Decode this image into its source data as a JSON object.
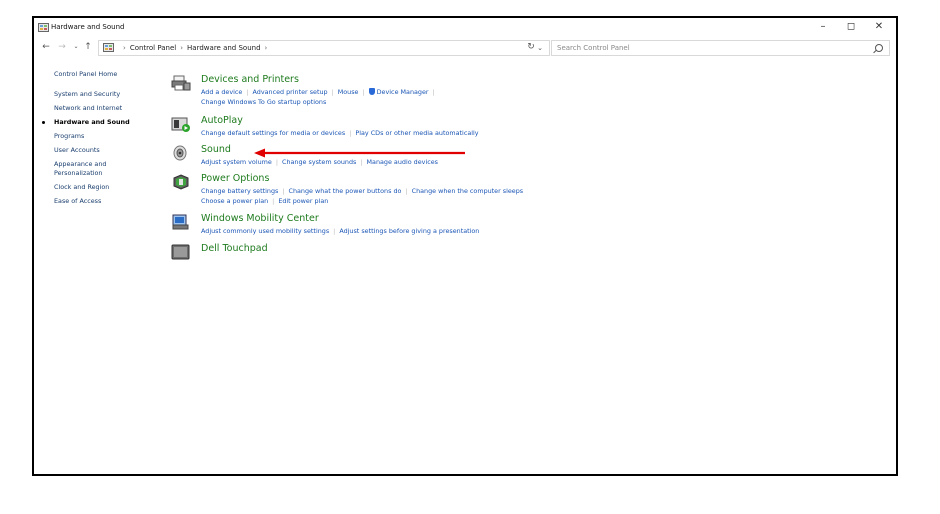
{
  "window": {
    "title": "Hardware and Sound",
    "controls": {
      "minimize": "–",
      "restore": "◻",
      "close": "✕"
    }
  },
  "nav": {
    "back_icon": "arrow-left-icon",
    "forward_icon": "arrow-right-icon",
    "recent_icon": "chevron-down-icon",
    "up_icon": "arrow-up-icon",
    "breadcrumbs": [
      "Control Panel",
      "Hardware and Sound"
    ],
    "search_placeholder": "Search Control Panel"
  },
  "sidebar": {
    "items": [
      {
        "label": "Control Panel Home"
      },
      {
        "label": "System and Security"
      },
      {
        "label": "Network and Internet"
      },
      {
        "label": "Hardware and Sound",
        "current": true
      },
      {
        "label": "Programs"
      },
      {
        "label": "User Accounts"
      },
      {
        "label": "Appearance and"
      },
      {
        "label": "Personalization"
      },
      {
        "label": "Clock and Region"
      },
      {
        "label": "Ease of Access"
      }
    ]
  },
  "categories": [
    {
      "title": "Devices and Printers",
      "icon": "printer-icon",
      "links_line1": [
        "Add a device",
        "Advanced printer setup",
        "Mouse",
        "Device Manager"
      ],
      "links_line2": [
        "Change Windows To Go startup options"
      ]
    },
    {
      "title": "AutoPlay",
      "icon": "autoplay-icon",
      "links_line1": [
        "Change default settings for media or devices",
        "Play CDs or other media automatically"
      ]
    },
    {
      "title": "Sound",
      "icon": "speaker-icon",
      "links_line1": [
        "Adjust system volume",
        "Change system sounds",
        "Manage audio devices"
      ]
    },
    {
      "title": "Power Options",
      "icon": "battery-icon",
      "links_line1": [
        "Change battery settings",
        "Change what the power buttons do",
        "Change when the computer sleeps"
      ],
      "links_line2": [
        "Choose a power plan",
        "Edit power plan"
      ]
    },
    {
      "title": "Windows Mobility Center",
      "icon": "mobility-center-icon",
      "links_line1": [
        "Adjust commonly used mobility settings",
        "Adjust settings before giving a presentation"
      ]
    },
    {
      "title": "Dell Touchpad",
      "icon": "touchpad-icon"
    }
  ],
  "annotation": {
    "color": "#e00000"
  },
  "colors": {
    "heading": "#1e7b1e",
    "link": "#1b56b5"
  }
}
